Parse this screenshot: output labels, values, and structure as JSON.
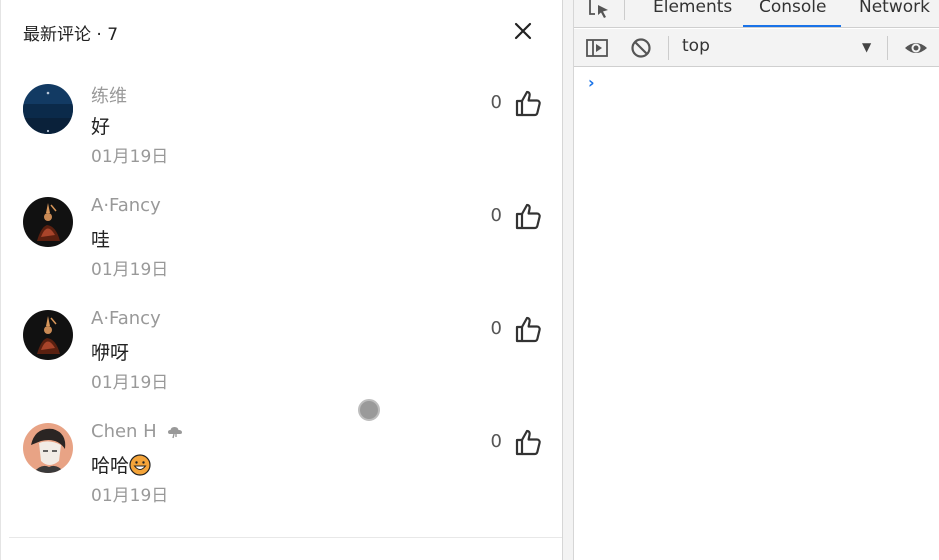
{
  "panel": {
    "title": "最新评论 · 7",
    "comments": [
      {
        "username": "练维",
        "text": "好",
        "date": "01月19日",
        "likes": "0",
        "avatar": "avatar-night-sky"
      },
      {
        "username": "A·Fancy",
        "text": "哇",
        "date": "01月19日",
        "likes": "0",
        "avatar": "avatar-dark-figure"
      },
      {
        "username": "A·Fancy",
        "text": "咿呀",
        "date": "01月19日",
        "likes": "0",
        "avatar": "avatar-dark-figure"
      },
      {
        "username": "Chen H",
        "text": "哈哈",
        "date": "01月19日",
        "likes": "0",
        "avatar": "avatar-cartoon-face",
        "badge": "cloud-badge-icon",
        "emoji": "grinning-emoji"
      }
    ]
  },
  "devtools": {
    "tabs": [
      "Elements",
      "Console",
      "Network"
    ],
    "active_tab": "Console",
    "context": "top",
    "prompt": "›"
  },
  "colors": {
    "accent": "#1a73e8",
    "muted_text": "#999999"
  }
}
